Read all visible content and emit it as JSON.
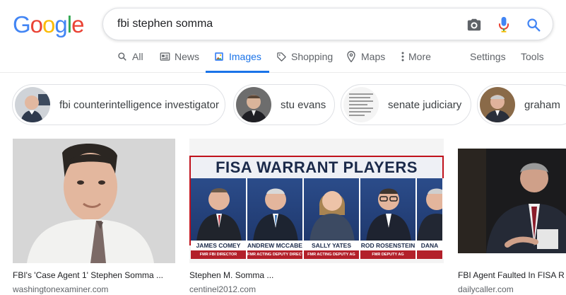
{
  "logo": {
    "text": "Google",
    "letters": [
      "G",
      "o",
      "o",
      "g",
      "l",
      "e"
    ],
    "colors": [
      "#4285f4",
      "#ea4335",
      "#fbbc05",
      "#4285f4",
      "#34a853",
      "#ea4335"
    ]
  },
  "search": {
    "query": "fbi stephen somma"
  },
  "nav": {
    "tabs": [
      {
        "label": "All",
        "icon": "search-icon"
      },
      {
        "label": "News",
        "icon": "news-icon"
      },
      {
        "label": "Images",
        "icon": "image-icon",
        "active": true
      },
      {
        "label": "Shopping",
        "icon": "tag-icon"
      },
      {
        "label": "Maps",
        "icon": "map-pin-icon"
      },
      {
        "label": "More",
        "icon": "more-vert-icon"
      }
    ],
    "settings": "Settings",
    "tools": "Tools"
  },
  "chips": [
    {
      "label": "fbi counterintelligence investigator"
    },
    {
      "label": "stu evans"
    },
    {
      "label": "senate judiciary"
    },
    {
      "label": "graham"
    }
  ],
  "results": [
    {
      "caption": "FBI's 'Case Agent 1' Stephen Somma ...",
      "source": "washingtonexaminer.com"
    },
    {
      "caption": "Stephen M. Somma ...",
      "source": "centinel2012.com",
      "graphic": {
        "title": "FISA WARRANT PLAYERS",
        "panels": [
          {
            "name": "JAMES COMEY",
            "role": "FMR FBI DIRECTOR"
          },
          {
            "name": "ANDREW MCCABE",
            "role": "FMR ACTING DEPUTY DIRECTOR"
          },
          {
            "name": "SALLY YATES",
            "role": "FMR ACTING DEPUTY AG"
          },
          {
            "name": "ROD ROSENSTEIN",
            "role": "FMR DEPUTY AG"
          },
          {
            "name": "DANA",
            "role": ""
          }
        ]
      }
    },
    {
      "caption": "FBI Agent Faulted In FISA R",
      "source": "dailycaller.com"
    }
  ],
  "colors": {
    "accent": "#1a73e8",
    "text_secondary": "#5f6368",
    "border": "#dfe1e5"
  }
}
